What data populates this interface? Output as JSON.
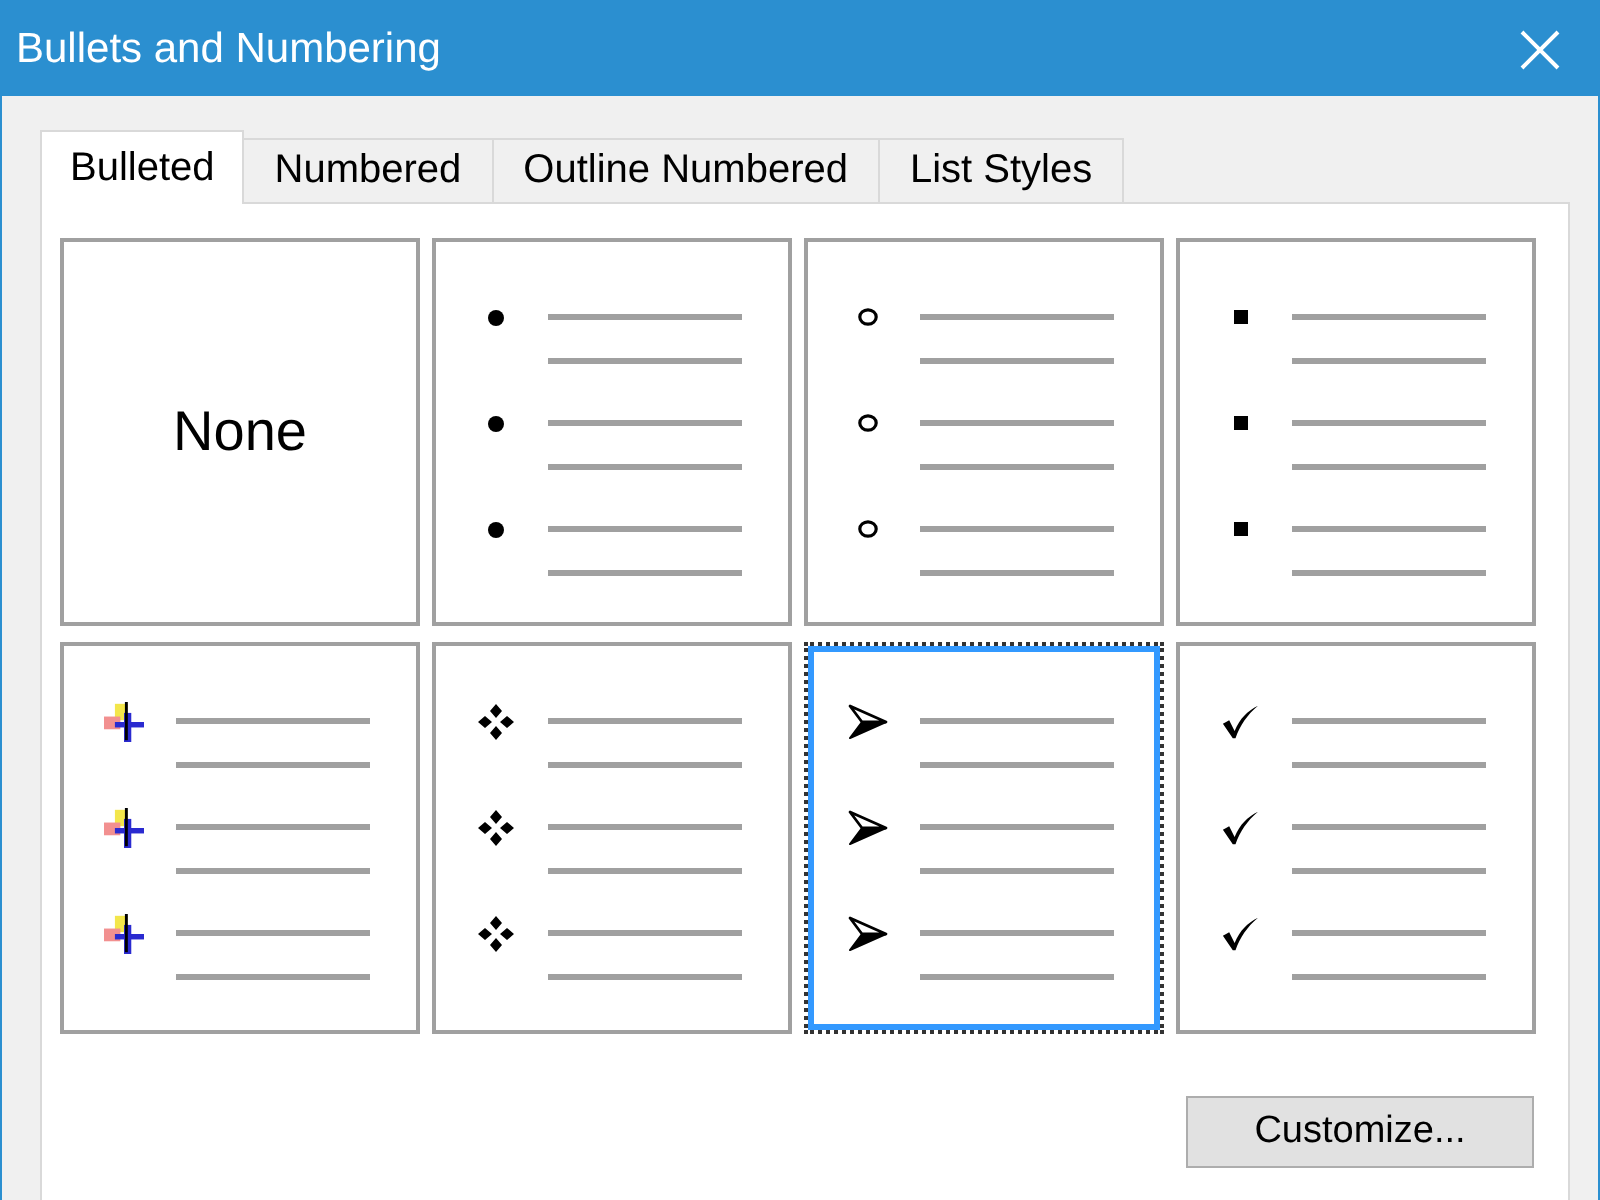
{
  "window": {
    "title": "Bullets and Numbering"
  },
  "tabs": [
    {
      "label": "Bulleted",
      "selected": true
    },
    {
      "label": "Numbered",
      "selected": false
    },
    {
      "label": "Outline Numbered",
      "selected": false
    },
    {
      "label": "List Styles",
      "selected": false
    }
  ],
  "bullet_styles": [
    {
      "kind": "none",
      "label": "None",
      "selected": false
    },
    {
      "kind": "dot",
      "selected": false
    },
    {
      "kind": "circle",
      "selected": false
    },
    {
      "kind": "square",
      "selected": false
    },
    {
      "kind": "picture",
      "selected": false
    },
    {
      "kind": "diamonds",
      "selected": false
    },
    {
      "kind": "arrowhead",
      "selected": true
    },
    {
      "kind": "check",
      "selected": false
    }
  ],
  "buttons": [
    {
      "label": "Customize..."
    }
  ]
}
